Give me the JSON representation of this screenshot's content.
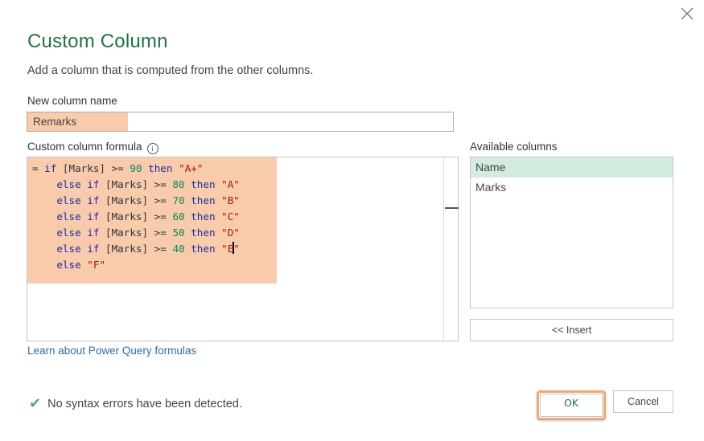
{
  "dialog": {
    "title": "Custom Column",
    "subtitle": "Add a column that is computed from the other columns.",
    "close_icon": "close-icon"
  },
  "new_column": {
    "label": "New column name",
    "value": "Remarks"
  },
  "formula": {
    "label": "Custom column formula",
    "info_icon": "info-icon",
    "info_glyph": "i",
    "lines": [
      {
        "prefix": "= ",
        "indent": "",
        "kw1": "if",
        "field": " [Marks] ",
        "op": ">=",
        "num": "90",
        "kw2": "then",
        "str": "\"A+\""
      },
      {
        "prefix": "",
        "indent": "    ",
        "kw1": "else if",
        "field": " [Marks] ",
        "op": ">=",
        "num": "80",
        "kw2": "then",
        "str": "\"A\""
      },
      {
        "prefix": "",
        "indent": "    ",
        "kw1": "else if",
        "field": " [Marks] ",
        "op": ">=",
        "num": "70",
        "kw2": "then",
        "str": "\"B\""
      },
      {
        "prefix": "",
        "indent": "    ",
        "kw1": "else if",
        "field": " [Marks] ",
        "op": ">=",
        "num": "60",
        "kw2": "then",
        "str": "\"C\""
      },
      {
        "prefix": "",
        "indent": "    ",
        "kw1": "else if",
        "field": " [Marks] ",
        "op": ">=",
        "num": "50",
        "kw2": "then",
        "str": "\"D\""
      },
      {
        "prefix": "",
        "indent": "    ",
        "kw1": "else if",
        "field": " [Marks] ",
        "op": ">=",
        "num": "40",
        "kw2": "then",
        "str_before_caret": "\"E",
        "str_after_caret": "\""
      }
    ],
    "last_line": {
      "indent": "    ",
      "kw": "else",
      "str": "\"F\""
    }
  },
  "available_columns": {
    "label": "Available columns",
    "items": [
      {
        "label": "Name",
        "selected": true
      },
      {
        "label": "Marks",
        "selected": false
      }
    ],
    "insert_button": "<< Insert"
  },
  "learn_link": "Learn about Power Query formulas",
  "status": {
    "icon": "check-icon",
    "glyph": "✔",
    "text": "No syntax errors have been detected."
  },
  "buttons": {
    "ok": "OK",
    "cancel": "Cancel"
  },
  "colors": {
    "accent": "#217346",
    "highlight": "#f8cbad",
    "selection": "#d4ecdf",
    "link": "#2e6da4",
    "keyword": "#1b2d9e",
    "number": "#098658",
    "string": "#a31515",
    "ok_focus": "#f0a879"
  }
}
